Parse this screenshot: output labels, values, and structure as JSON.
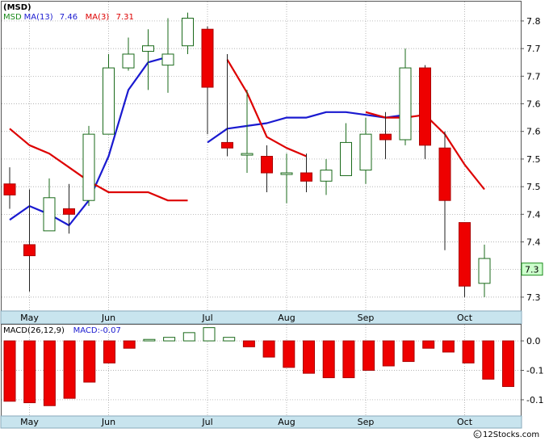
{
  "chart_data": [
    {
      "type": "candlestick",
      "title": "(MSD)",
      "legend": [
        {
          "text": "MSD",
          "color": "#1a8a1a"
        },
        {
          "text": "MA(13)",
          "color": "#1a1ad0"
        },
        {
          "text": "7.46",
          "color": "#1a1ad0"
        },
        {
          "text": "MA(3)",
          "color": "#dd0000"
        },
        {
          "text": "7.31",
          "color": "#dd0000"
        }
      ],
      "x_ticks": [
        "May",
        "Jun",
        "Jul",
        "Aug",
        "Sep",
        "Oct"
      ],
      "y_ticks": [
        7.25,
        7.3,
        7.35,
        7.4,
        7.45,
        7.5,
        7.55,
        7.6,
        7.65,
        7.7,
        7.75
      ],
      "y_tick_labels": [
        "7.3",
        "7.3",
        "7.4",
        "7.4",
        "7.5",
        "7.5",
        "7.6",
        "7.6",
        "7.7",
        "7.7",
        "7.8"
      ],
      "ylim": [
        7.225,
        7.785
      ],
      "last_price_label": "7.3",
      "last_price": 7.3,
      "candles": [
        {
          "o": 7.455,
          "c": 7.435,
          "h": 7.485,
          "l": 7.41
        },
        {
          "o": 7.345,
          "c": 7.325,
          "h": 7.445,
          "l": 7.26
        },
        {
          "o": 7.37,
          "c": 7.43,
          "h": 7.465,
          "l": 7.37
        },
        {
          "o": 7.41,
          "c": 7.4,
          "h": 7.455,
          "l": 7.365
        },
        {
          "o": 7.425,
          "c": 7.545,
          "h": 7.56,
          "l": 7.415
        },
        {
          "o": 7.545,
          "c": 7.665,
          "h": 7.69,
          "l": 7.545
        },
        {
          "o": 7.665,
          "c": 7.69,
          "h": 7.72,
          "l": 7.66
        },
        {
          "o": 7.695,
          "c": 7.705,
          "h": 7.735,
          "l": 7.625
        },
        {
          "o": 7.67,
          "c": 7.69,
          "h": 7.755,
          "l": 7.62
        },
        {
          "o": 7.705,
          "c": 7.755,
          "h": 7.765,
          "l": 7.69
        },
        {
          "o": 7.735,
          "c": 7.63,
          "h": 7.74,
          "l": 7.545
        },
        {
          "o": 7.53,
          "c": 7.52,
          "h": 7.69,
          "l": 7.505
        },
        {
          "o": 7.51,
          "c": 7.51,
          "h": 7.625,
          "l": 7.475
        },
        {
          "o": 7.505,
          "c": 7.475,
          "h": 7.525,
          "l": 7.44
        },
        {
          "o": 7.475,
          "c": 7.475,
          "h": 7.51,
          "l": 7.42
        },
        {
          "o": 7.475,
          "c": 7.46,
          "h": 7.51,
          "l": 7.44
        },
        {
          "o": 7.46,
          "c": 7.48,
          "h": 7.5,
          "l": 7.435
        },
        {
          "o": 7.47,
          "c": 7.53,
          "h": 7.565,
          "l": 7.47
        },
        {
          "o": 7.48,
          "c": 7.545,
          "h": 7.575,
          "l": 7.455
        },
        {
          "o": 7.545,
          "c": 7.535,
          "h": 7.585,
          "l": 7.5
        },
        {
          "o": 7.535,
          "c": 7.665,
          "h": 7.7,
          "l": 7.525
        },
        {
          "o": 7.665,
          "c": 7.525,
          "h": 7.67,
          "l": 7.5
        },
        {
          "o": 7.52,
          "c": 7.425,
          "h": 7.55,
          "l": 7.335
        },
        {
          "o": 7.385,
          "c": 7.27,
          "h": 7.385,
          "l": 7.25
        },
        {
          "o": 7.275,
          "c": 7.32,
          "h": 7.345,
          "l": 7.25
        }
      ],
      "series": [
        {
          "name": "MA(13)",
          "color": "#1a1ad0",
          "values": [
            7.39,
            7.415,
            7.4,
            7.38,
            7.425,
            7.505,
            7.625,
            7.675,
            7.685,
            null,
            7.53,
            7.555,
            7.56,
            7.565,
            7.575,
            7.575,
            7.585,
            7.585,
            7.58,
            7.575,
            7.58,
            null,
            null,
            null,
            null
          ]
        },
        {
          "name": "MA(3)",
          "color": "#dd0000",
          "values": [
            7.555,
            7.525,
            7.51,
            7.485,
            7.46,
            7.44,
            7.44,
            7.44,
            7.425,
            7.425,
            null,
            7.68,
            7.62,
            7.54,
            7.52,
            7.505,
            null,
            null,
            7.585,
            7.575,
            7.575,
            7.58,
            7.545,
            7.49,
            7.445
          ]
        }
      ]
    },
    {
      "type": "bar",
      "legend": [
        {
          "text": "MACD(26,12,9)",
          "color": "#000000"
        },
        {
          "text": "MACD:-0.07",
          "color": "#1a1ad0"
        }
      ],
      "x_ticks": [
        "May",
        "Jun",
        "Jul",
        "Aug",
        "Sep",
        "Oct"
      ],
      "y_ticks": [
        0.0,
        -0.1,
        -0.2
      ],
      "y_tick_labels": [
        "0.0",
        "-0.1",
        "-0.1"
      ],
      "ylim": [
        -0.255,
        0.055
      ],
      "values": [
        -0.205,
        -0.21,
        -0.22,
        -0.195,
        -0.14,
        -0.075,
        -0.025,
        0.005,
        0.012,
        0.028,
        0.045,
        0.012,
        -0.02,
        -0.055,
        -0.09,
        -0.11,
        -0.125,
        -0.125,
        -0.1,
        -0.085,
        -0.07,
        -0.025,
        -0.038,
        -0.075,
        -0.13,
        -0.155
      ]
    }
  ]
}
